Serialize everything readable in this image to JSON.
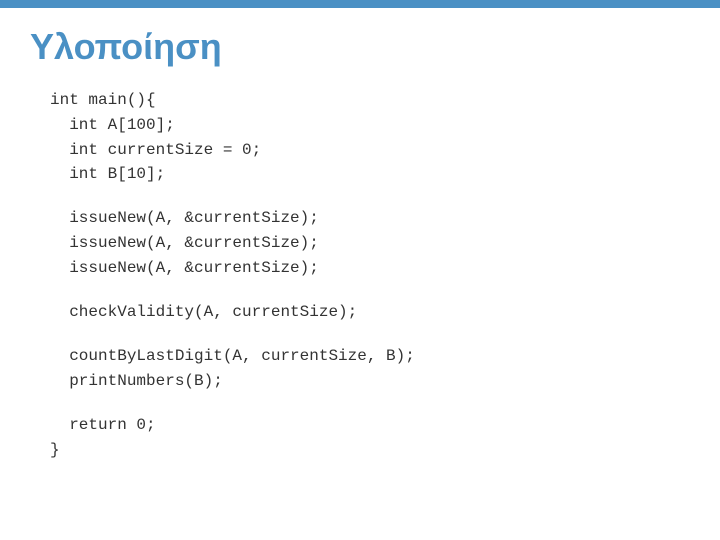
{
  "header": {
    "title": "Υλοποίηση",
    "accent_color": "#4a90c4"
  },
  "code": {
    "lines": [
      {
        "id": "l1",
        "text": "int main(){",
        "blank_after": false
      },
      {
        "id": "l2",
        "text": "  int A[100];",
        "blank_after": false
      },
      {
        "id": "l3",
        "text": "  int currentSize = 0;",
        "blank_after": false
      },
      {
        "id": "l4",
        "text": "  int B[10];",
        "blank_after": true
      },
      {
        "id": "l5",
        "text": "  issueNew(A, &currentSize);",
        "blank_after": false
      },
      {
        "id": "l6",
        "text": "  issueNew(A, &currentSize);",
        "blank_after": false
      },
      {
        "id": "l7",
        "text": "  issueNew(A, &currentSize);",
        "blank_after": true
      },
      {
        "id": "l8",
        "text": "  checkValidity(A, currentSize);",
        "blank_after": true
      },
      {
        "id": "l9",
        "text": "  countByLastDigit(A, currentSize, B);",
        "blank_after": false
      },
      {
        "id": "l10",
        "text": "  printNumbers(B);",
        "blank_after": true
      },
      {
        "id": "l11",
        "text": "  return 0;",
        "blank_after": false
      },
      {
        "id": "l12",
        "text": "}",
        "blank_after": false
      }
    ]
  }
}
